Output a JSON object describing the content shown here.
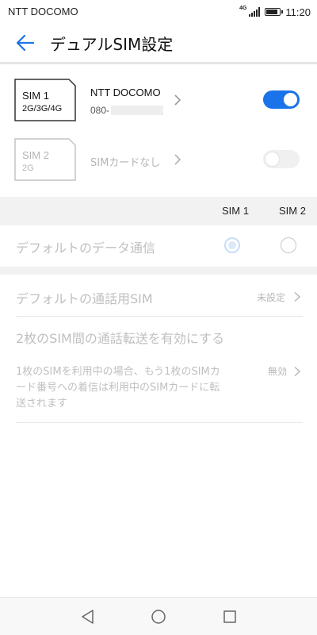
{
  "status_bar": {
    "carrier": "NTT DOCOMO",
    "network": "4G",
    "time": "11:20"
  },
  "header": {
    "title": "デュアルSIM設定"
  },
  "sim1": {
    "card_name": "SIM 1",
    "card_networks": "2G/3G/4G",
    "carrier": "NTT DOCOMO",
    "number_prefix": "080-",
    "enabled": true
  },
  "sim2": {
    "card_name": "SIM 2",
    "card_networks": "2G",
    "status": "SIMカードなし",
    "enabled": false
  },
  "columns": {
    "sim1": "SIM 1",
    "sim2": "SIM 2"
  },
  "default_data": {
    "label": "デフォルトのデータ通信",
    "selected": "SIM 1"
  },
  "default_call": {
    "label": "デフォルトの通話用SIM",
    "value": "未設定"
  },
  "call_forwarding": {
    "label": "2枚のSIM間の通話転送を有効にする",
    "description": "1枚のSIMを利用中の場合、もう1枚のSIMカード番号への着信は利用中のSIMカードに転送されます",
    "value": "無効"
  },
  "colors": {
    "accent": "#1a73e8",
    "disabled_text": "#c0c0c0"
  }
}
